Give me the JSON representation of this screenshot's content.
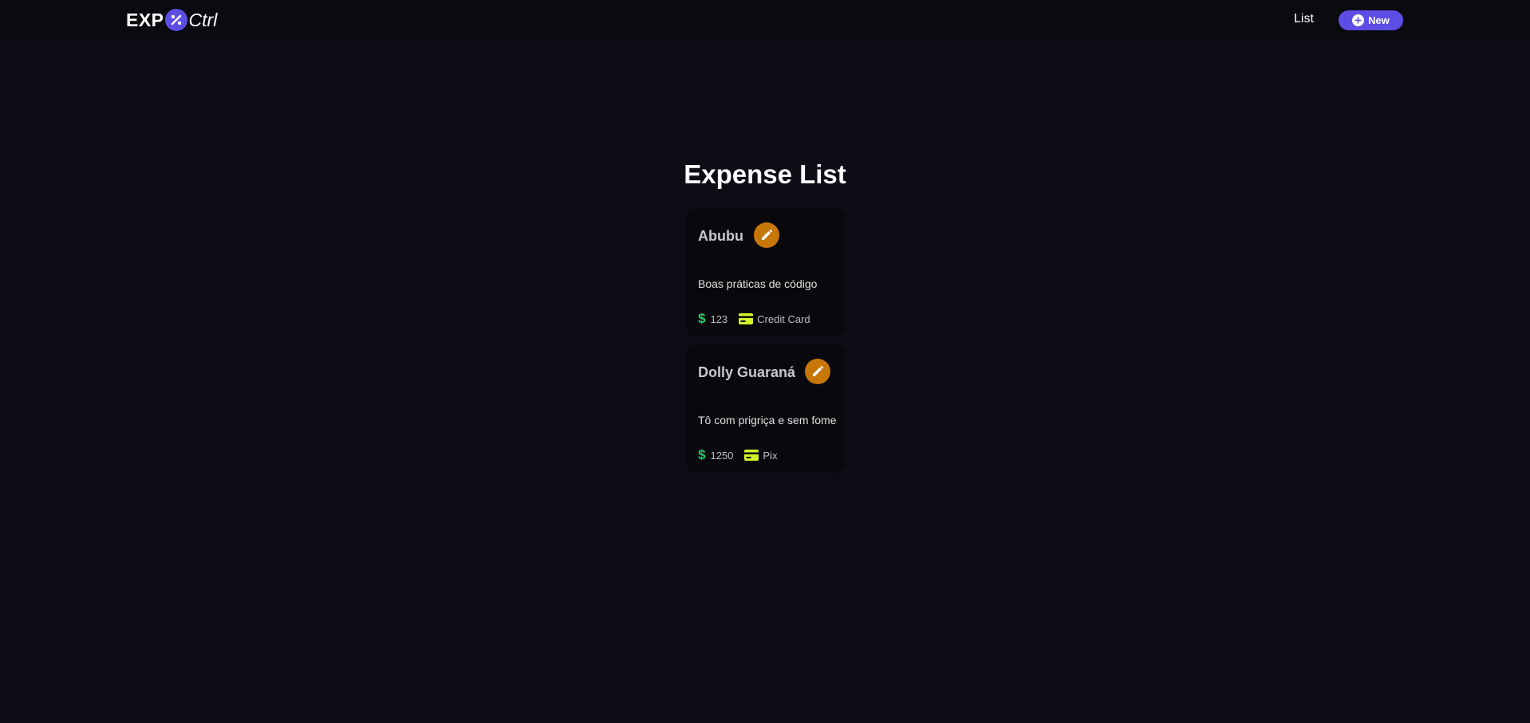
{
  "app": {
    "logo_prefix": "EXP",
    "logo_suffix": "Ctrl"
  },
  "nav": {
    "list_label": "List",
    "new_label": "New"
  },
  "main": {
    "title": "Expense List"
  },
  "expenses": [
    {
      "title": "Abubu",
      "description": "Boas práticas de código",
      "amount": "123",
      "payment_method": "Credit Card"
    },
    {
      "title": "Dolly Guaraná",
      "description": "Tô com prigriça e sem fome",
      "amount": "1250",
      "payment_method": "Pix"
    }
  ],
  "colors": {
    "background": "#0e0d16",
    "navbar": "#0a0a0f",
    "accent": "#5c4ee5",
    "edit_button": "#c77708",
    "amount_icon": "#29c76b",
    "card_icon": "#d4f12a"
  },
  "icons": {
    "logo_badge": "percent-icon",
    "new_button": "plus-circle-icon",
    "edit": "pencil-icon",
    "amount": "dollar-icon",
    "payment": "credit-card-icon"
  }
}
